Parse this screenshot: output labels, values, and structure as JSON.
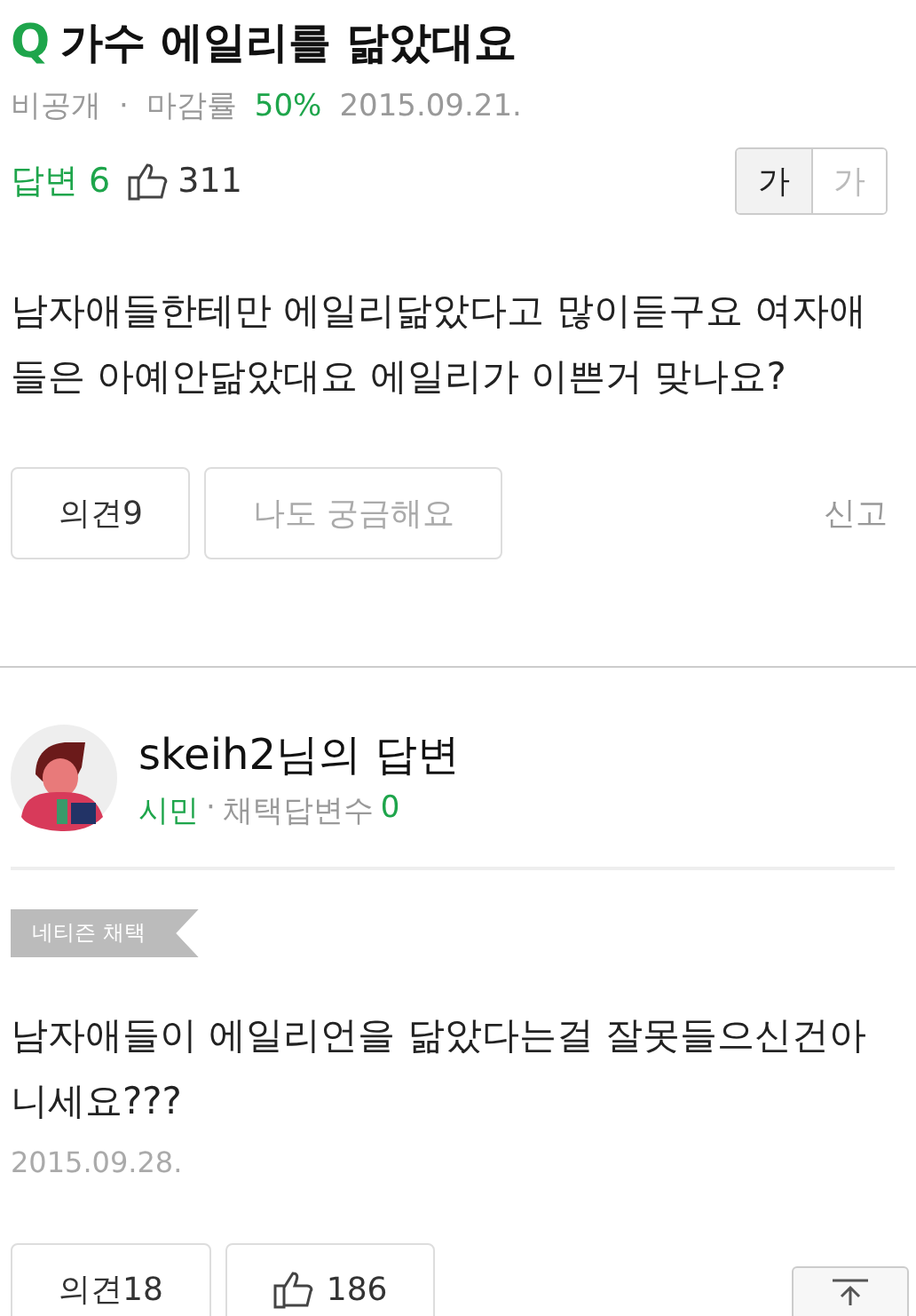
{
  "question": {
    "q_mark": "Q",
    "title": "가수 에일리를 닮았대요",
    "visibility": "비공개",
    "separator": "·",
    "close_rate_label": "마감률",
    "close_rate": "50%",
    "date": "2015.09.21.",
    "answers_label": "답변 6",
    "likes": "311",
    "font_sizes": [
      {
        "label": "가",
        "selected": true
      },
      {
        "label": "가",
        "selected": false
      }
    ],
    "body": "남자애들한테만 에일리닮았다고 많이듣구요 여자애들은 아예안닮았대요 에일리가 이쁜거 맞나요?",
    "buttons": [
      {
        "label": "의견9"
      },
      {
        "label": "나도 궁금해요",
        "disabled": true
      }
    ],
    "report": "신고"
  },
  "answer": {
    "title": "skeih2님의 답변",
    "rank": "시민",
    "separator": "·",
    "adopted_label": "채택답변수",
    "adopted_count": "0",
    "badge": "네티즌 채택",
    "body": "남자애들이 에일리언을 닮았다는걸 잘못들으신건아니세요???",
    "date": "2015.09.28.",
    "comment_button": "의견18",
    "likes": "186"
  }
}
